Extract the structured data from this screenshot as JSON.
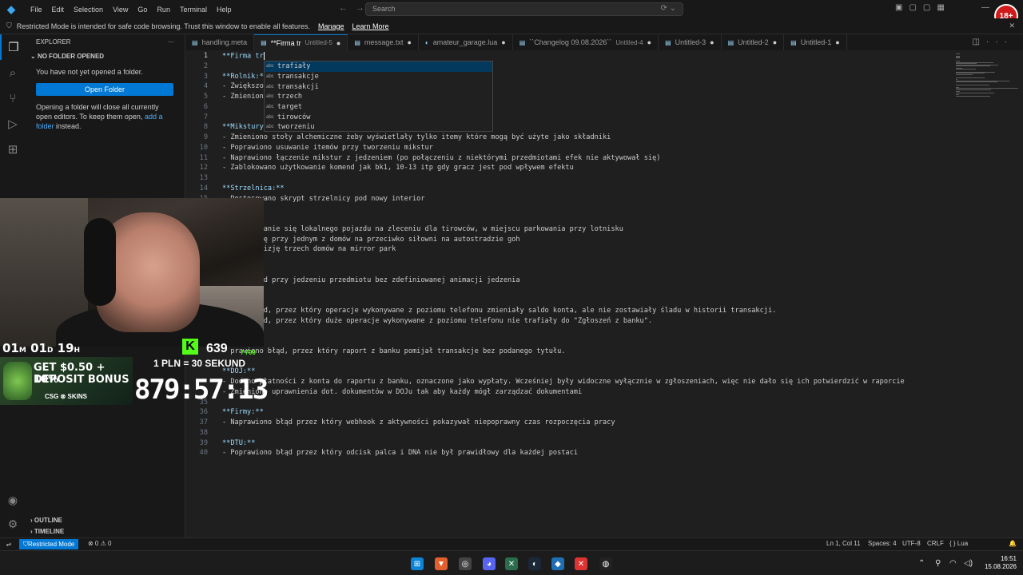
{
  "menu": [
    "File",
    "Edit",
    "Selection",
    "View",
    "Go",
    "Run",
    "Terminal",
    "Help"
  ],
  "search": {
    "placeholder": "Search"
  },
  "banner": {
    "text": "Restricted Mode is intended for safe code browsing. Trust this window to enable all features.",
    "manage": "Manage",
    "learn": "Learn More"
  },
  "sidebar": {
    "title": "EXPLORER",
    "section": "NO FOLDER OPENED",
    "empty_msg": "You have not yet opened a folder.",
    "open_button": "Open Folder",
    "note_a": "Opening a folder will close all currently open editors. To keep them open,",
    "note_link": "add a folder",
    "note_b": "instead.",
    "outline": "OUTLINE",
    "timeline": "TIMELINE"
  },
  "tabs": [
    {
      "label": "handling.meta",
      "sub": ""
    },
    {
      "label": "**Firma tr",
      "sub": "Untitled-5"
    },
    {
      "label": "message.txt",
      "sub": ""
    },
    {
      "label": "amateur_garage.lua",
      "sub": ""
    },
    {
      "label": "``Changelog 09.08.2026``",
      "sub": "Untitled-4"
    },
    {
      "label": "Untitled-3",
      "sub": ""
    },
    {
      "label": "Untitled-2",
      "sub": ""
    },
    {
      "label": "Untitled-1",
      "sub": ""
    }
  ],
  "editor_lines": [
    {
      "n": "1",
      "t": "**Firma tr"
    },
    {
      "n": "2",
      "t": ""
    },
    {
      "n": "3",
      "t": "**Rolnik:*"
    },
    {
      "n": "4",
      "t": "- Zwiększo"
    },
    {
      "n": "5",
      "t": "- Zmienion"
    },
    {
      "n": "6",
      "t": ""
    },
    {
      "n": "7",
      "t": ""
    },
    {
      "n": "8",
      "t": "**Mikstury"
    },
    {
      "n": "9",
      "t": "- Zmieniono stoły alchemiczne żeby wyświetlały tylko itemy które mogą być użyte jako składniki"
    },
    {
      "n": "10",
      "t": "- Poprawiono usuwanie itemów przy tworzeniu mikstur"
    },
    {
      "n": "11",
      "t": "- Naprawiono łączenie mikstur z jedzeniem (po połączeniu z niektórymi przedmiotami efek nie aktywował się)"
    },
    {
      "n": "12",
      "t": "- Zablokowano użytkowanie komend jak bk1, 10-13 itp gdy gracz jest pod wpływem efektu"
    },
    {
      "n": "13",
      "t": ""
    },
    {
      "n": "14",
      "t": "**Strzelnica:**"
    },
    {
      "n": "15",
      "t": "- Dostosowano skrypt strzelnicy pod nowy interior"
    },
    {
      "n": "",
      "t": ""
    },
    {
      "n": "",
      "t": ""
    },
    {
      "n": "",
      "t": "    pojawianie się lokalnego pojazdu na zleceniu dla tirowców, w miejscu parkowania przy lotnisku"
    },
    {
      "n": "",
      "t": "    kolizję przy jednym z domów na przeciwko siłowni na autostradzie goh"
    },
    {
      "n": "",
      "t": "   ono kolizję trzech domów na mirror park"
    },
    {
      "n": "",
      "t": ""
    },
    {
      "n": "",
      "t": ""
    },
    {
      "n": "",
      "t": "   ono błąd przy jedzeniu przedmiotu bez zdefiniowanej animacji jedzenia"
    },
    {
      "n": "",
      "t": ""
    },
    {
      "n": "",
      "t": "   *"
    },
    {
      "n": "",
      "t": "   ono błąd, przez który operacje wykonywane z poziomu telefonu zmieniały saldo konta, ale nie zostawiały śladu w historii transakcji."
    },
    {
      "n": "",
      "t": "   ono błąd, przez który duże operacje wykonywane z poziomu telefonu nie trafiały do \"Zgłoszeń z banku\"."
    },
    {
      "n": "",
      "t": ""
    },
    {
      "n": "",
      "t": ""
    },
    {
      "n": "",
      "t": "  prawiono błąd, przez który raport z banku pomijał transakcje bez podanego tytułu."
    },
    {
      "n": "",
      "t": ""
    },
    {
      "n": "",
      "t": "**DOJ:**"
    },
    {
      "n": "",
      "t": "- Dodano płatności z konta do raportu z banku, oznaczone jako wypłaty. Wcześniej były widoczne wyłącznie w zgłoszeniach, więc nie dało się ich potwierdzić w raporcie"
    },
    {
      "n": "",
      "t": "- Zmieniono uprawnienia dot. dokumentów w DOJu tak aby każdy mógł zarządzać dokumentami"
    },
    {
      "n": "35",
      "t": ""
    },
    {
      "n": "36",
      "t": "**Firmy:**"
    },
    {
      "n": "37",
      "t": "- Naprawiono błąd przez który webhook z aktywności pokazywał niepoprawny czas rozpoczęcia pracy"
    },
    {
      "n": "38",
      "t": ""
    },
    {
      "n": "39",
      "t": "**DTU:**"
    },
    {
      "n": "40",
      "t": "- Poprawiono błąd przez który odcisk palca i DNA nie był prawidłowy dla każdej postaci"
    }
  ],
  "suggestions": [
    "trafiały",
    "transakcje",
    "transakcji",
    "trzech",
    "target",
    "tirowców",
    "tworzeniu"
  ],
  "stream": {
    "kick_count": "639",
    "kick_goal": "/ 700",
    "days": "01",
    "days_unit": "M",
    "days2": "01",
    "days2_unit": "D",
    "hours": "19",
    "hours_unit": "H",
    "promo_line1": "GET $0.50 + 10%",
    "promo_line2": "DEPOSIT BONUS",
    "promo_brand": "CSG ⊗ SKINS",
    "rate": "1 PLN = 30 SEKUND",
    "timer": "879:57:13",
    "age_badge": "18+"
  },
  "status": {
    "restricted": "Restricted Mode",
    "errors": "⊗ 0 ⚠ 0",
    "position": "Ln 1, Col 11",
    "spaces": "Spaces: 4",
    "encoding": "UTF-8",
    "eol": "CRLF",
    "language": "{ } Lua"
  },
  "clock": {
    "time": "16:51",
    "date": "15.08.2026"
  }
}
